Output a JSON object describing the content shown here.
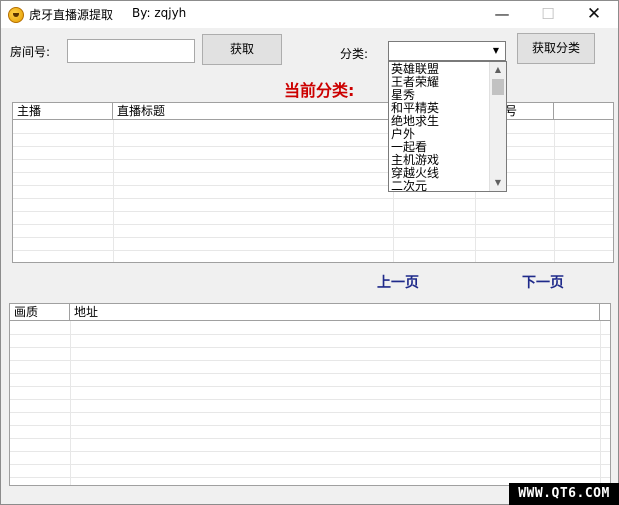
{
  "titlebar": {
    "title": "虎牙直播源提取",
    "author": "By:  zqjyh",
    "minimize": "—",
    "maximize": "☐",
    "close": "✕"
  },
  "controls": {
    "room_label": "房间号:",
    "room_value": "",
    "fetch_button": "获取",
    "category_label": "分类:",
    "category_value": "",
    "fetch_category_button": "获取分类"
  },
  "current_category_label": "当前分类:",
  "dropdown": {
    "options": [
      "英雄联盟",
      "王者荣耀",
      "星秀",
      "和平精英",
      "绝地求生",
      "户外",
      "一起看",
      "主机游戏",
      "穿越火线",
      "二次元"
    ]
  },
  "top_table": {
    "columns": [
      "主播",
      "直播标题",
      "",
      "号",
      ""
    ]
  },
  "pagination": {
    "prev": "上一页",
    "next": "下一页"
  },
  "bottom_table": {
    "columns": [
      "画质",
      "地址",
      ""
    ]
  },
  "watermark": "WWW.QT6.COM"
}
